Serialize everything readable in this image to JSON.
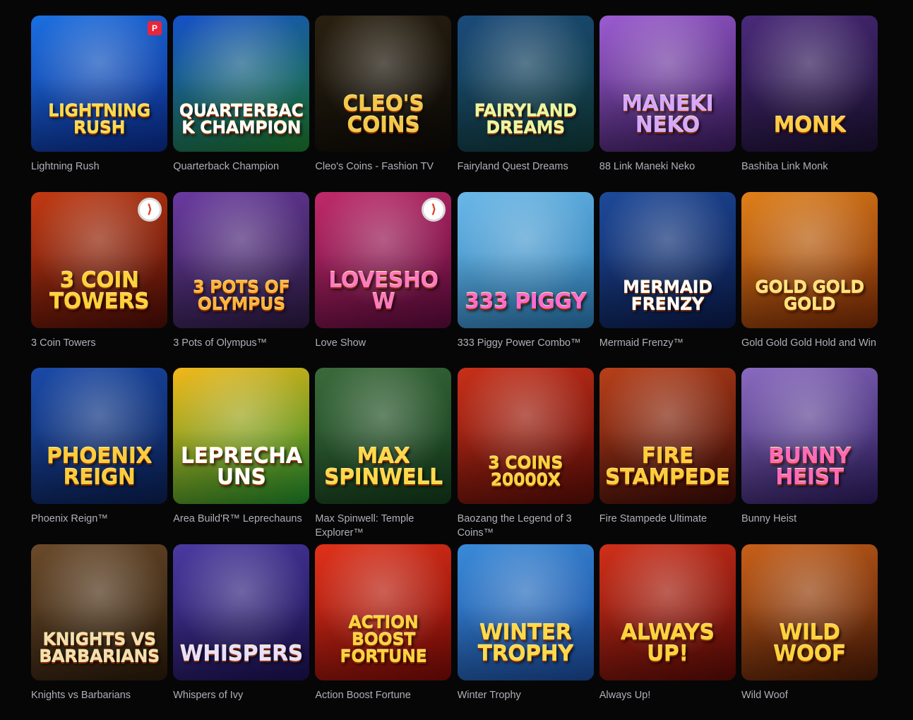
{
  "games": [
    {
      "title": "Lightning Rush",
      "logo": "Lightning Rush",
      "bg": [
        "#1c6fe0",
        "#0a2a8a"
      ],
      "logo_color": "#ffd94a",
      "badge": "P"
    },
    {
      "title": "Quarterback Champion",
      "logo": "Quarterback Champion",
      "bg": [
        "#1550c8",
        "#1c7a2a"
      ],
      "logo_color": "#ffffff",
      "badge": ""
    },
    {
      "title": "Cleo's Coins - Fashion TV",
      "logo": "Cleo's Coins",
      "bg": [
        "#2a2010",
        "#0c0a06"
      ],
      "logo_color": "#f2c84a",
      "badge": ""
    },
    {
      "title": "Fairyland Quest Dreams",
      "logo": "Fairyland Dreams",
      "bg": [
        "#1b4a7a",
        "#0f3a38"
      ],
      "logo_color": "#e9f7a0",
      "badge": ""
    },
    {
      "title": "88 Link Maneki Neko",
      "logo": "Maneki Neko",
      "bg": [
        "#9b5cd0",
        "#3a1b5e"
      ],
      "logo_color": "#d6a8ff",
      "badge": ""
    },
    {
      "title": "Bashiba Link Monk",
      "logo": "Monk",
      "bg": [
        "#4a2a7a",
        "#1a1030"
      ],
      "logo_color": "#ffcc44",
      "badge": ""
    },
    {
      "title": "3 Coin Towers",
      "logo": "3 Coin Towers",
      "bg": [
        "#c23a12",
        "#4a0c06"
      ],
      "logo_color": "#ffd23a",
      "badge": "⟩"
    },
    {
      "title": "3 Pots of Olympus™",
      "logo": "3 Pots of Olympus",
      "bg": [
        "#6a3aa0",
        "#2a1a40"
      ],
      "logo_color": "#ffb43a",
      "badge": ""
    },
    {
      "title": "Love Show",
      "logo": "Loveshow",
      "bg": [
        "#c02a6a",
        "#5a0a3a"
      ],
      "logo_color": "#ff7ac0",
      "badge": "⟩"
    },
    {
      "title": "333 Piggy Power Combo™",
      "logo": "333 Piggy",
      "bg": [
        "#6ab8e8",
        "#2a78b0"
      ],
      "logo_color": "#ff6ad0",
      "badge": ""
    },
    {
      "title": "Mermaid Frenzy™",
      "logo": "Mermaid Frenzy",
      "bg": [
        "#1e4a9a",
        "#0a1a4a"
      ],
      "logo_color": "#ffffff",
      "badge": ""
    },
    {
      "title": "Gold Gold Gold Hold and Win",
      "logo": "Gold Gold Gold",
      "bg": [
        "#e0801a",
        "#7a2a06"
      ],
      "logo_color": "#ffe27a",
      "badge": ""
    },
    {
      "title": "Phoenix Reign™",
      "logo": "Phoenix Reign",
      "bg": [
        "#1a4aa8",
        "#0a1e50"
      ],
      "logo_color": "#ffcc3a",
      "badge": ""
    },
    {
      "title": "Area Build'R™ Leprechauns",
      "logo": "Leprechauns",
      "bg": [
        "#f2b81a",
        "#1e8a2a"
      ],
      "logo_color": "#ffffff",
      "badge": ""
    },
    {
      "title": "Max Spinwell: Temple Explorer™",
      "logo": "Max Spinwell",
      "bg": [
        "#3a6a3a",
        "#123a1a"
      ],
      "logo_color": "#ffd94a",
      "badge": ""
    },
    {
      "title": "Baozang the Legend of 3 Coins™",
      "logo": "3 Coins 20000X",
      "bg": [
        "#c8301a",
        "#5a0c06"
      ],
      "logo_color": "#ffd23a",
      "badge": ""
    },
    {
      "title": "Fire Stampede Ultimate",
      "logo": "Fire Stampede",
      "bg": [
        "#b8401a",
        "#3a0a06"
      ],
      "logo_color": "#ffcc3a",
      "badge": ""
    },
    {
      "title": "Bunny Heist",
      "logo": "Bunny Heist",
      "bg": [
        "#8a6ac0",
        "#2a1a5a"
      ],
      "logo_color": "#ff6ab8",
      "badge": ""
    },
    {
      "title": "Knights vs Barbarians",
      "logo": "Knights vs Barbarians",
      "bg": [
        "#6a4a2a",
        "#2a1a0a"
      ],
      "logo_color": "#f2e0b0",
      "badge": ""
    },
    {
      "title": "Whispers of Ivy",
      "logo": "Whispers",
      "bg": [
        "#4a3aa0",
        "#1a1050"
      ],
      "logo_color": "#e8e0ff",
      "badge": ""
    },
    {
      "title": "Action Boost Fortune",
      "logo": "Action Boost Fortune",
      "bg": [
        "#e0321a",
        "#7a0a06"
      ],
      "logo_color": "#ffd23a",
      "badge": ""
    },
    {
      "title": "Winter Trophy",
      "logo": "Winter Trophy",
      "bg": [
        "#3a8ad8",
        "#1a4a9a"
      ],
      "logo_color": "#ffd94a",
      "badge": ""
    },
    {
      "title": "Always Up!",
      "logo": "Always Up!",
      "bg": [
        "#d0301a",
        "#5a0a06"
      ],
      "logo_color": "#ffd23a",
      "badge": ""
    },
    {
      "title": "Wild Woof",
      "logo": "Wild Woof",
      "bg": [
        "#c8601a",
        "#4a1a06"
      ],
      "logo_color": "#ffd23a",
      "badge": ""
    }
  ],
  "colors": {
    "background": "#060607",
    "caption": "#aeb0b6"
  }
}
